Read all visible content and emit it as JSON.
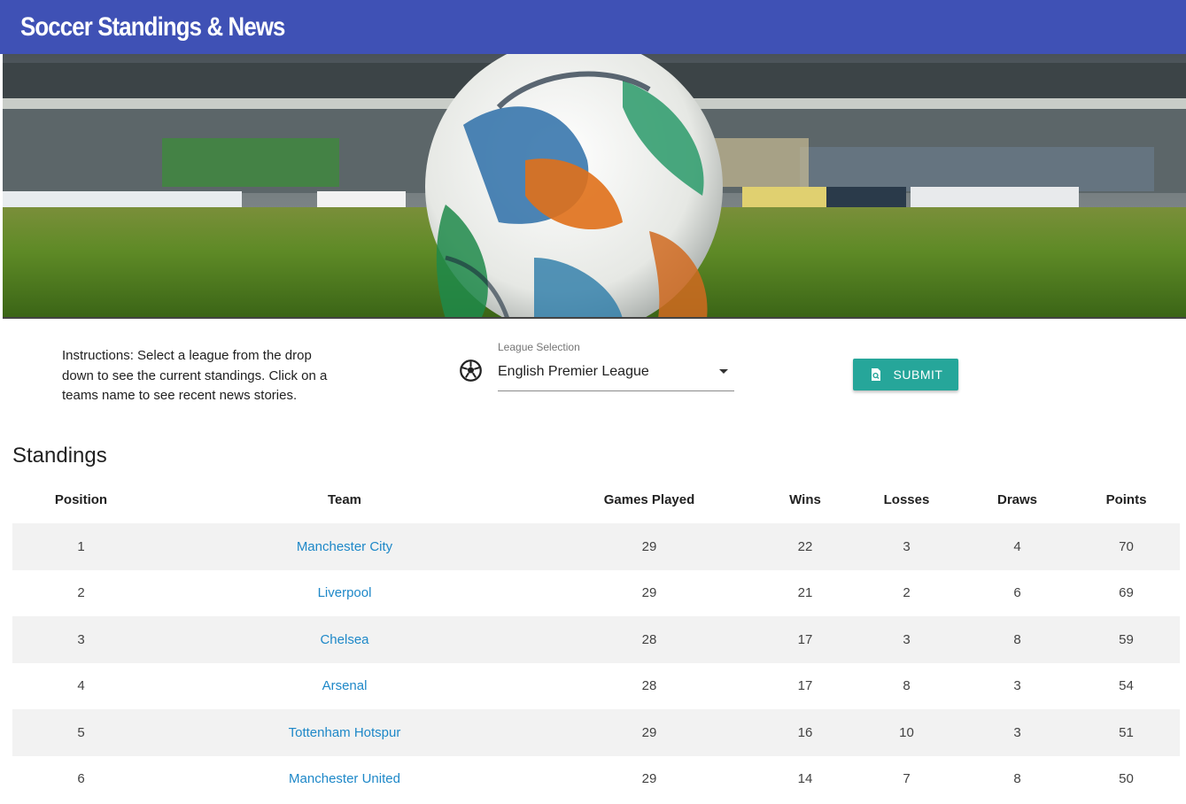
{
  "app": {
    "title": "Soccer Standings & News"
  },
  "hero": {
    "image_description_icon": "soccer-ball-stadium-image"
  },
  "controls": {
    "instructions": "Instructions: Select a league from the drop down to see the current standings. Click on a teams name to see recent news stories.",
    "league_icon": "soccer-ball-icon",
    "league_label": "League Selection",
    "league_value": "English Premier League",
    "submit_label": "SUBMIT",
    "submit_icon": "search-document-icon"
  },
  "standings": {
    "heading": "Standings",
    "columns": [
      "Position",
      "Team",
      "Games Played",
      "Wins",
      "Losses",
      "Draws",
      "Points"
    ],
    "rows": [
      {
        "position": "1",
        "team": "Manchester City",
        "games_played": "29",
        "wins": "22",
        "losses": "3",
        "draws": "4",
        "points": "70"
      },
      {
        "position": "2",
        "team": "Liverpool",
        "games_played": "29",
        "wins": "21",
        "losses": "2",
        "draws": "6",
        "points": "69"
      },
      {
        "position": "3",
        "team": "Chelsea",
        "games_played": "28",
        "wins": "17",
        "losses": "3",
        "draws": "8",
        "points": "59"
      },
      {
        "position": "4",
        "team": "Arsenal",
        "games_played": "28",
        "wins": "17",
        "losses": "8",
        "draws": "3",
        "points": "54"
      },
      {
        "position": "5",
        "team": "Tottenham Hotspur",
        "games_played": "29",
        "wins": "16",
        "losses": "10",
        "draws": "3",
        "points": "51"
      },
      {
        "position": "6",
        "team": "Manchester United",
        "games_played": "29",
        "wins": "14",
        "losses": "7",
        "draws": "8",
        "points": "50"
      }
    ]
  },
  "colors": {
    "app_bar": "#3f51b5",
    "submit_button": "#26a69a",
    "team_link": "#1e88c8",
    "row_stripe": "#f2f2f2"
  }
}
